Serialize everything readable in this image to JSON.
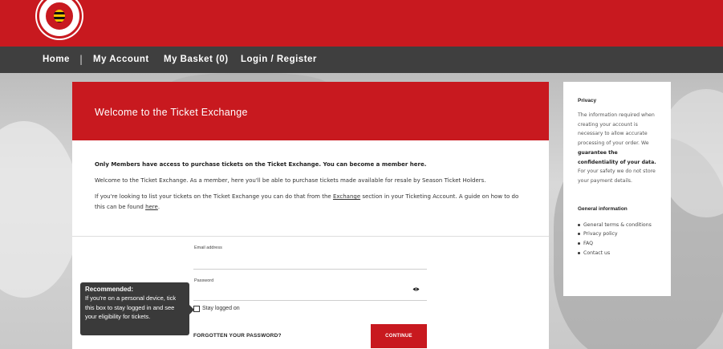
{
  "header": {
    "logo_alt": "Brentford Football Club crest",
    "brand_color": "#c8191f"
  },
  "nav": {
    "home": "Home",
    "separator": "|",
    "my_account": "My Account",
    "my_basket": "My Basket (0)",
    "login_register": "Login / Register"
  },
  "main": {
    "title": "Welcome to the Ticket Exchange",
    "members_notice": "Only Members have access to purchase tickets on the Ticket Exchange. You can become a member here.",
    "welcome_text": "Welcome to the Ticket Exchange. As a member, here you'll be able to purchase tickets made available for resale by Season Ticket Holders.",
    "list_text_1": "If you're looking to list your tickets on the Ticket Exchange you can do that from the ",
    "list_link": "Exchange",
    "list_text_2": " section in your Ticketing Account. A guide on how to do this can be found ",
    "here_link": "here",
    "list_text_3": "."
  },
  "login": {
    "email_label": "Email address",
    "email_value": "",
    "password_label": "Password",
    "password_value": "",
    "stay_logged_on": "Stay logged on",
    "forgot_password": "FORGOTTEN YOUR PASSWORD?",
    "continue": "CONTINUE",
    "eye_icon": "eye-icon"
  },
  "tooltip": {
    "title": "Recommended:",
    "body": "If you're on a personal device, tick this box to stay logged in and see your eligibility for tickets."
  },
  "sidebar": {
    "privacy_heading": "Privacy",
    "privacy_text_1": "The information required when creating your account is necessary to allow accurate processing of your order. We ",
    "privacy_bold": "guarantee the confidentiality of your data.",
    "privacy_text_2": " For your safety we do not store your payment details.",
    "general_heading": "General information",
    "links": [
      "General terms & conditions",
      "Privacy policy",
      "FAQ",
      "Contact us"
    ]
  }
}
